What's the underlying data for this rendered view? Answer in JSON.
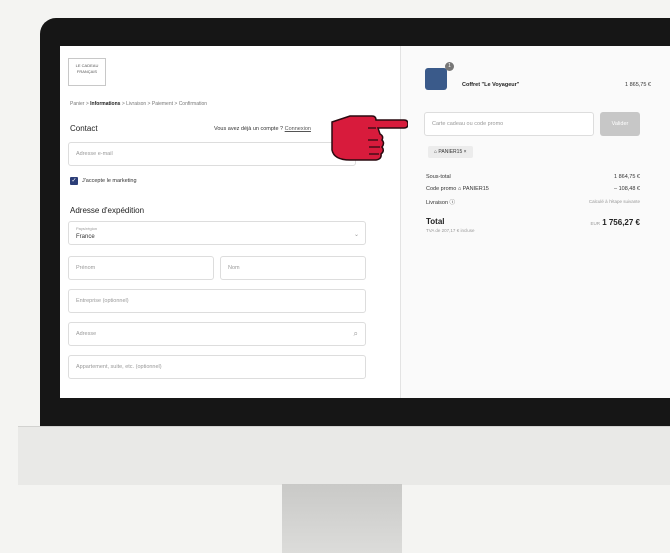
{
  "logo": {
    "line1": "LE CADEAU",
    "line2": "FRANÇAIS"
  },
  "breadcrumb": [
    "Panier",
    "Informations",
    "Livraison",
    "Paiement",
    "Confirmation"
  ],
  "contact": {
    "heading": "Contact",
    "have_account": "Vous avez déjà un compte ?",
    "login_link": "Connexion",
    "email_placeholder": "Adresse e-mail",
    "marketing_label": "J'accepte le marketing"
  },
  "shipping": {
    "heading": "Adresse d'expédition",
    "country_label": "Pays/région",
    "country_value": "France",
    "first_name": "Prénom",
    "last_name": "Nom",
    "company": "Entreprise (optionnel)",
    "address": "Adresse",
    "apartment": "Appartement, suite, etc. (optionnel)"
  },
  "order": {
    "quantity": "1",
    "product_name": "Coffret \"Le Voyageur\"",
    "product_price": "1 865,75 €",
    "discount_placeholder": "Carte cadeau ou code promo",
    "apply_label": "Valider",
    "applied_code": "PANIER15",
    "subtotal_label": "Sous-total",
    "subtotal_value": "1 864,75 €",
    "promo_label": "Code promo",
    "promo_code": "PANIER15",
    "promo_value": "– 108,48 €",
    "shipping_label": "Livraison",
    "shipping_value": "Calculé à l'étape suivante",
    "total_label": "Total",
    "taxes_note": "TVA de 207,17 € incluse",
    "currency": "EUR",
    "total_value": "1 756,27 €"
  }
}
